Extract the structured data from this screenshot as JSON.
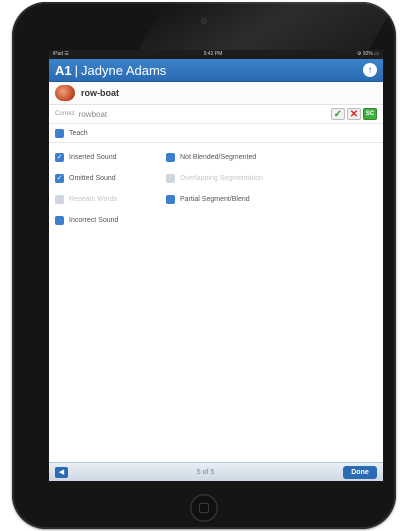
{
  "status_bar": {
    "carrier": "iPad ☰",
    "time": "5:42 PM",
    "battery": "⚙ 92% ▭"
  },
  "header": {
    "code": "A1",
    "separator": "|",
    "name": "Jadyne Adams",
    "upload_icon": "↑"
  },
  "word": {
    "text": "row-boat"
  },
  "correct": {
    "label": "Correct",
    "value": "rowboat"
  },
  "score_buttons": {
    "correct": "✓",
    "incorrect": "✕",
    "sc": "SC"
  },
  "teach": {
    "label": "Teach",
    "checked": false
  },
  "options": [
    {
      "label": "Inserted Sound",
      "checked": true,
      "enabled": true
    },
    {
      "label": "Not Blended/Segmented",
      "checked": false,
      "enabled": true
    },
    {
      "label": "Omitted Sound",
      "checked": true,
      "enabled": true
    },
    {
      "label": "Overlapping Segmentation",
      "checked": false,
      "enabled": false
    },
    {
      "label": "Repeats Words",
      "checked": false,
      "enabled": false
    },
    {
      "label": "Partial Segment/Blend",
      "checked": false,
      "enabled": true
    },
    {
      "label": "Incorrect Sound",
      "checked": false,
      "enabled": true
    }
  ],
  "footer": {
    "back_icon": "◀",
    "page": "5 of 5",
    "done_label": "Done"
  }
}
